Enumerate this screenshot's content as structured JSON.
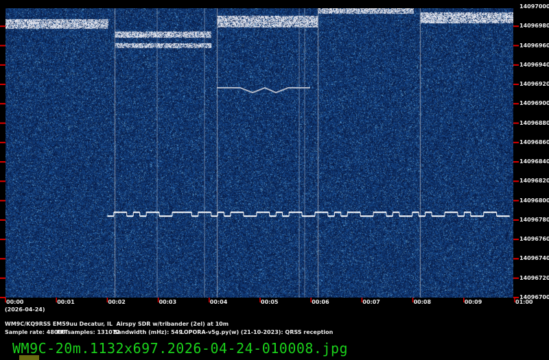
{
  "chart_data": {
    "type": "heatmap",
    "title": "QRSS spectrogram",
    "x_ticks": [
      "00:00",
      "00:01",
      "00:02",
      "00:03",
      "00:04",
      "00:05",
      "00:06",
      "00:07",
      "00:08",
      "00:09",
      "01:00"
    ],
    "x_range_minutes": [
      0,
      10
    ],
    "date_label": "(2026-04-24)",
    "y_ticks": [
      "14097000",
      "14096980",
      "14096960",
      "14096940",
      "14096920",
      "14096900",
      "14096880",
      "14096860",
      "14096840",
      "14096820",
      "14096800",
      "14096780",
      "14096760",
      "14096740",
      "14096720",
      "14096700"
    ],
    "y_range_hz": [
      14096700,
      14097000
    ],
    "signal": {
      "start_min": 2.0,
      "end_min": 9.9,
      "low_hz": 14096784,
      "high_hz": 14096788,
      "pattern": [
        0,
        1,
        1,
        0,
        1,
        0,
        1,
        1,
        0,
        0,
        1,
        1,
        1,
        0,
        1,
        1,
        0,
        1,
        0,
        1,
        1,
        0,
        0,
        1,
        1,
        0,
        1,
        0,
        1,
        1,
        0,
        0,
        1,
        1,
        0,
        1,
        0,
        1,
        1,
        0,
        0,
        1,
        1,
        0,
        1,
        0,
        0,
        1,
        0,
        1,
        0,
        0,
        1,
        1,
        0,
        1,
        0,
        0,
        1,
        1,
        0,
        0
      ]
    },
    "colors": {
      "background": "#0a2a6a",
      "signal": "#ffffff",
      "tick": "#e00000"
    }
  },
  "info": {
    "line1": "WM9C/KQ9RSS EM59uu Decatur, IL  Airspy SDR w/tribander (2el) at 10m",
    "sample_rate": "Sample rate: 48000",
    "fft": "FFTsamples: 131072",
    "bandwidth": "Bandwidth (mHz): 549",
    "software": "LOPORA-v5g.py(w) (21-10-2023): QRSS reception"
  },
  "filename": "WM9C-20m.1132x697.2026-04-24-010008.jpg"
}
